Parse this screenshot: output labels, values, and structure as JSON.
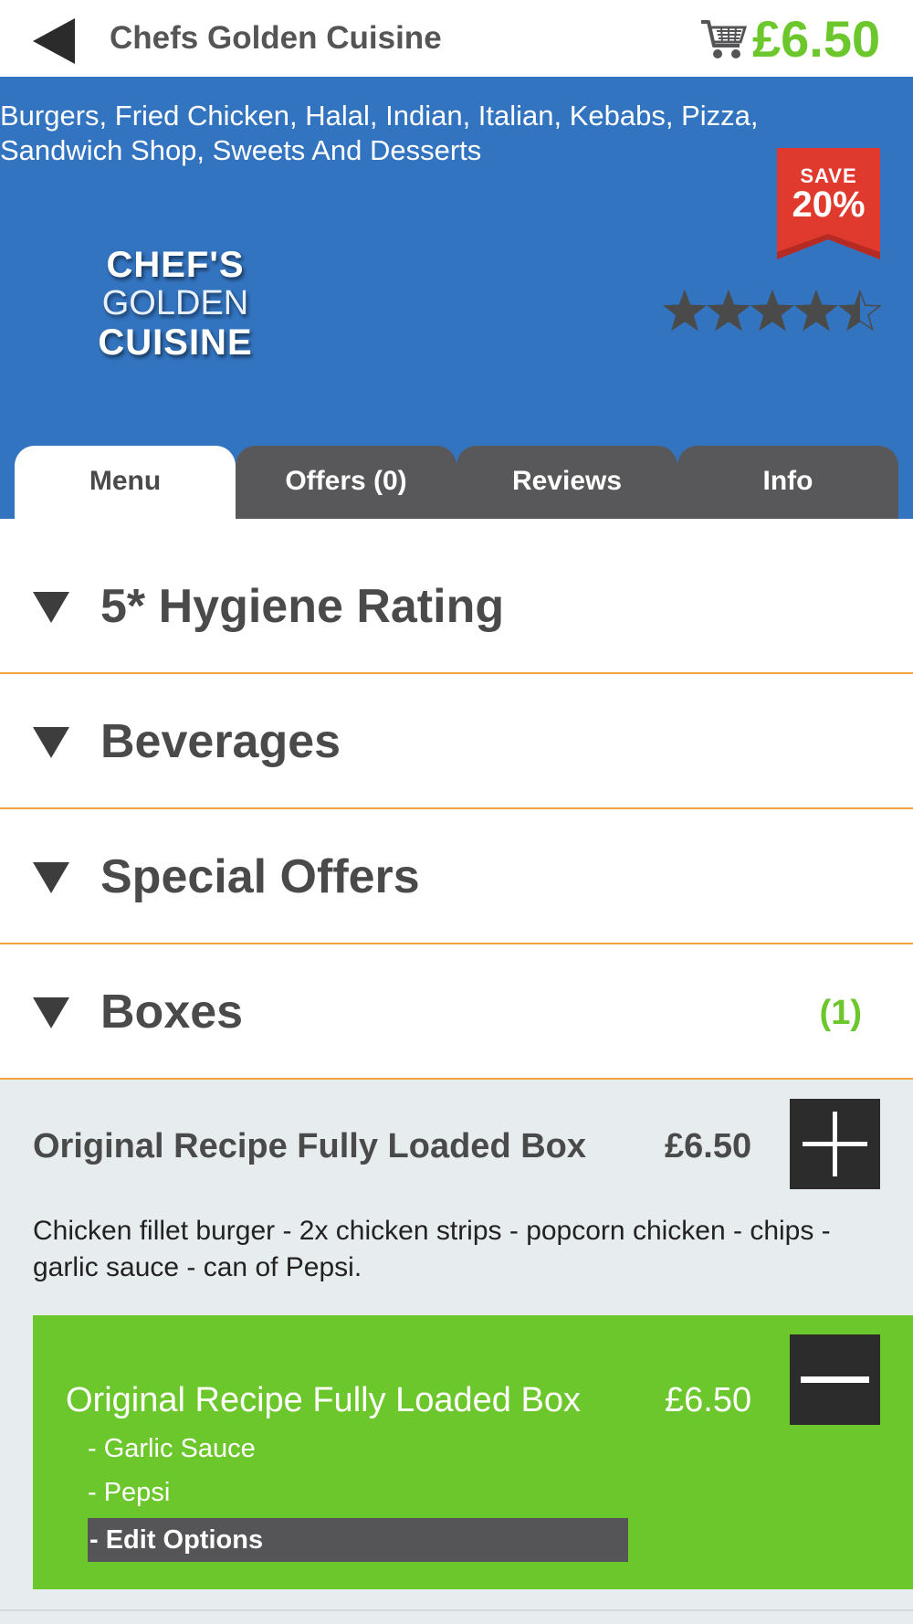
{
  "header": {
    "back_icon": "back-arrow-icon",
    "title": "Chefs Golden Cuisine",
    "cart_icon": "shopping-cart-icon",
    "cart_total": "£6.50"
  },
  "restaurant": {
    "cuisines": "Burgers, Fried Chicken, Halal, Indian, Italian, Kebabs, Pizza, Sandwich Shop, Sweets And Desserts",
    "save_label": "SAVE",
    "save_percent": "20%",
    "logo_line1": "CHEF'S",
    "logo_line2": "GOLDEN",
    "logo_line3": "CUISINE",
    "rating": 4.5,
    "rating_max": 5
  },
  "tabs": [
    {
      "label": "Menu",
      "active": true
    },
    {
      "label": "Offers (0)",
      "active": false
    },
    {
      "label": "Reviews",
      "active": false
    },
    {
      "label": "Info",
      "active": false
    }
  ],
  "sections": [
    {
      "title": "5* Hygiene Rating",
      "count": ""
    },
    {
      "title": "Beverages",
      "count": ""
    },
    {
      "title": "Special Offers",
      "count": ""
    },
    {
      "title": "Boxes",
      "count": "(1)"
    }
  ],
  "menu_item": {
    "name": "Original Recipe Fully Loaded Box",
    "price": "£6.50",
    "description": "Chicken fillet burger - 2x chicken strips - popcorn chicken - chips - garlic sauce - can of Pepsi."
  },
  "basket_item": {
    "name": "Original Recipe Fully Loaded Box",
    "price": "£6.50",
    "options": [
      "- Garlic Sauce",
      "- Pepsi"
    ],
    "edit_label": "- Edit Options"
  },
  "colors": {
    "brand_blue": "#3374c0",
    "accent_green": "#6cc72d",
    "divider_orange": "#f3a33b",
    "save_red": "#e03a2f",
    "dark_button": "#2c2c2c"
  }
}
